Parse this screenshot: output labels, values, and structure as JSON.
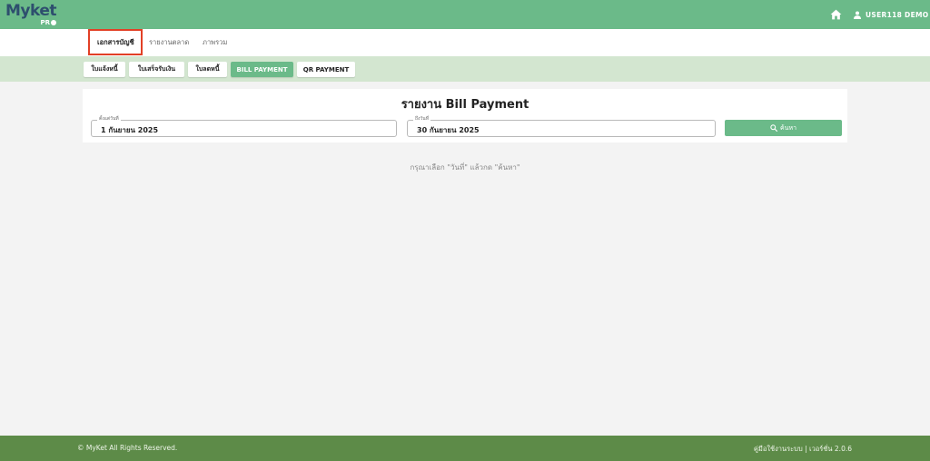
{
  "brand": {
    "name": "Myket",
    "sub": "PR"
  },
  "header": {
    "user_name": "USER118 DEMO",
    "home_icon": "home-icon",
    "user_icon": "person-icon"
  },
  "main_nav": [
    {
      "label": "เอกสารบัญชี",
      "active": true
    },
    {
      "label": "รายงานตลาด",
      "active": false
    },
    {
      "label": "ภาพรวม",
      "active": false
    }
  ],
  "sub_nav": [
    {
      "label": "ใบแจ้งหนี้",
      "active": false
    },
    {
      "label": "ใบเสร็จรับเงิน",
      "active": false
    },
    {
      "label": "ใบลดหนี้",
      "active": false
    },
    {
      "label": "BILL PAYMENT",
      "active": true
    },
    {
      "label": "QR PAYMENT",
      "active": false
    }
  ],
  "report": {
    "title": "รายงาน Bill Payment",
    "start_label": "ตั้งแต่วันที่",
    "start_value": "1 กันยายน 2025",
    "end_label": "ถึงวันที่",
    "end_value": "30 กันยายน 2025",
    "search_label": "ค้นหา",
    "hint": "กรุณาเลือก \"วันที่\" แล้วกด \"ค้นหา\""
  },
  "footer": {
    "copyright": "© MyKet All Rights Reserved.",
    "manual": "คู่มือใช้งานระบบ",
    "separator": " | ",
    "version": "เวอร์ชั่น 2.0.6"
  },
  "colors": {
    "header": "#6bba89",
    "subnav": "#d3e6d0",
    "footer": "#5d8b48",
    "highlight": "#e24026"
  }
}
